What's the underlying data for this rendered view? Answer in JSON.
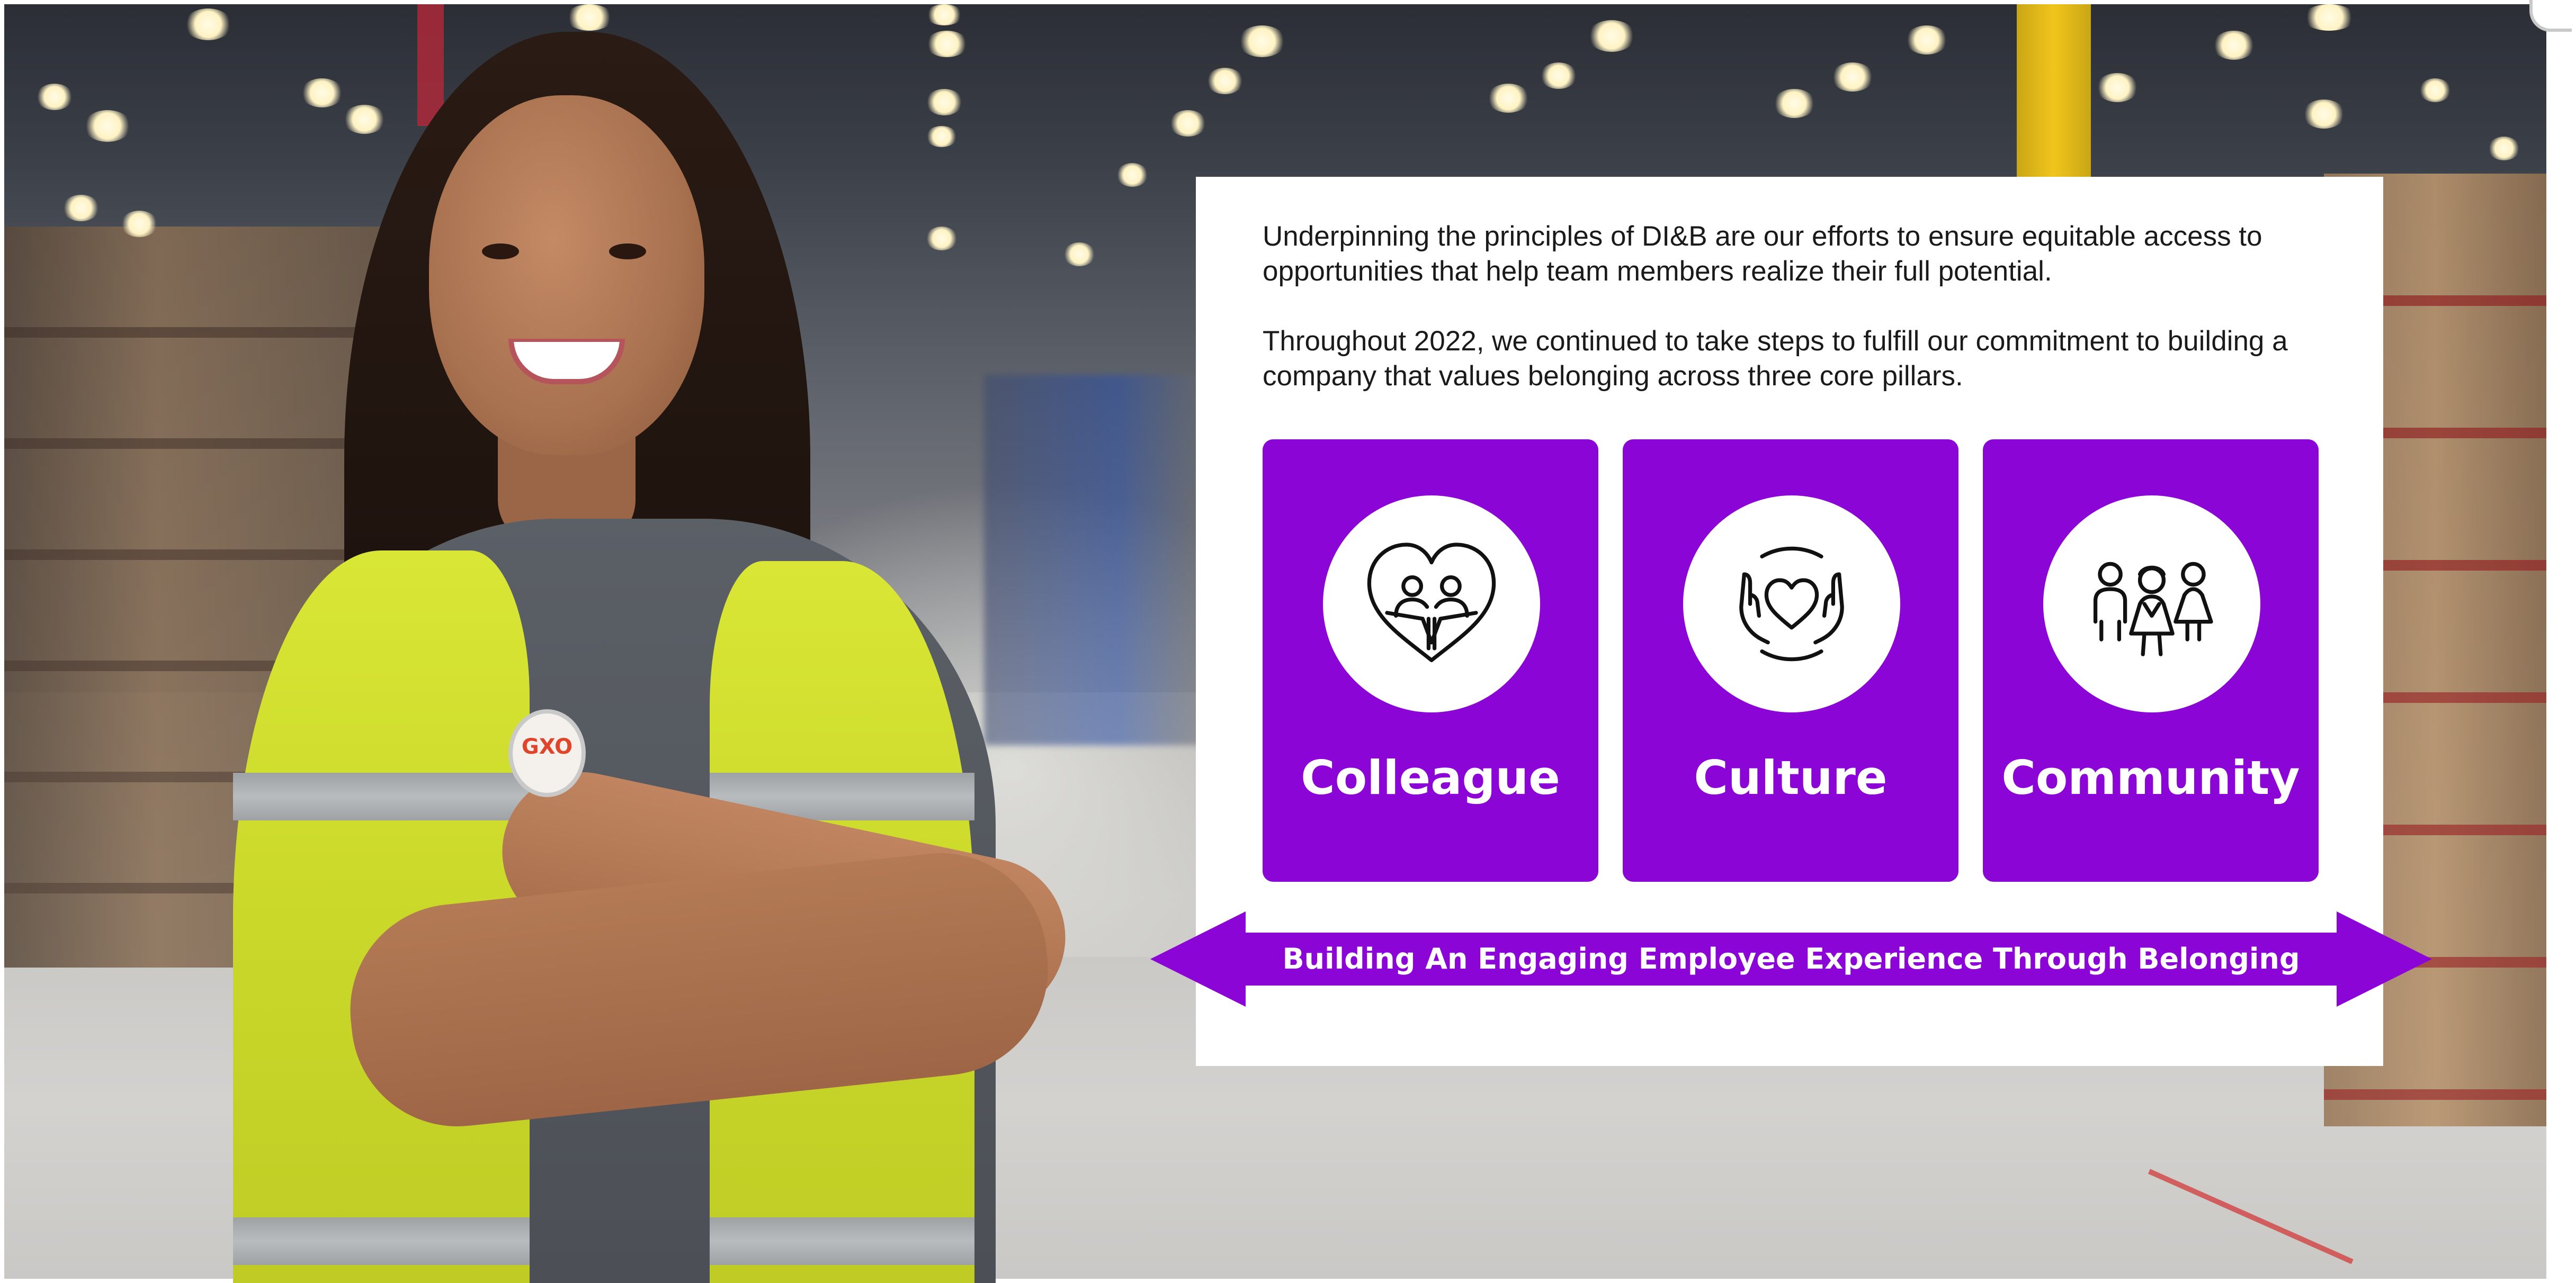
{
  "intro": {
    "paragraph_1": "Underpinning the principles of DI&B are our efforts to ensure equitable access to opportunities that help team members realize their full potential.",
    "paragraph_2": "Throughout 2022, we continued to take steps to fulfill our commitment to building a company that values belonging across three core pillars."
  },
  "pillars": [
    {
      "label": "Colleague",
      "icon": "heart-people-icon"
    },
    {
      "label": "Culture",
      "icon": "hands-heart-icon"
    },
    {
      "label": "Community",
      "icon": "group-people-icon"
    }
  ],
  "banner": {
    "text": "Building An Engaging Employee Experience Through Belonging"
  },
  "photo": {
    "badge_text": "GXO"
  },
  "colors": {
    "pillar_purple": "#8a05d6",
    "card_background": "#ffffff",
    "body_text": "#1a1a1a"
  }
}
